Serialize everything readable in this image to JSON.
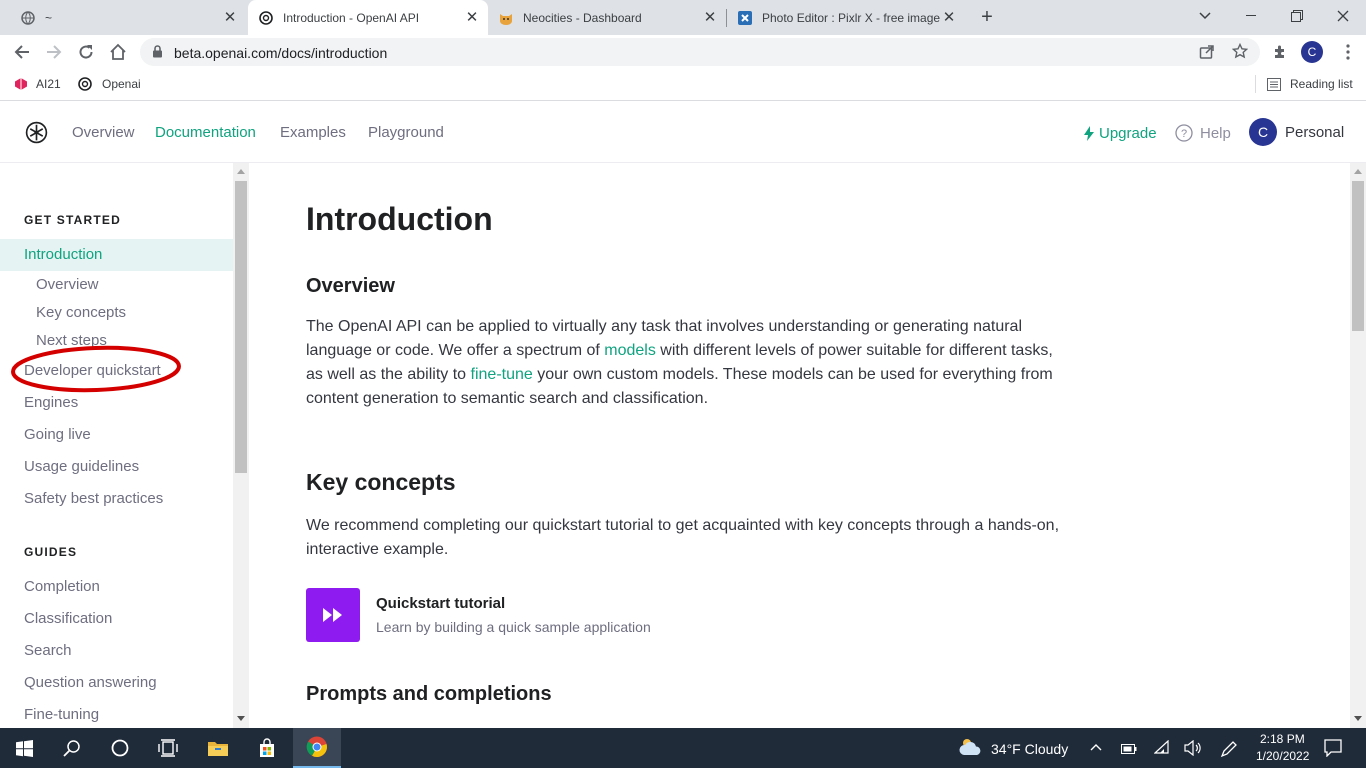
{
  "browser": {
    "tabs": [
      {
        "title": "~",
        "favicon": "globe-icon"
      },
      {
        "title": "Introduction - OpenAI API",
        "favicon": "openai-icon"
      },
      {
        "title": "Neocities - Dashboard",
        "favicon": "neocities-cat-icon"
      },
      {
        "title": "Photo Editor : Pixlr X - free image",
        "favicon": "pixlr-icon"
      }
    ],
    "url": "beta.openai.com/docs/introduction",
    "profile_initial": "C",
    "bookmarks": [
      {
        "label": "AI21",
        "icon": "ai21-icon"
      },
      {
        "label": "Openai",
        "icon": "openai-icon"
      }
    ],
    "reading_list": "Reading list"
  },
  "site": {
    "nav": [
      "Overview",
      "Documentation",
      "Examples",
      "Playground"
    ],
    "active_nav": "Documentation",
    "upgrade": "Upgrade",
    "help": "Help",
    "account_initial": "C",
    "account_name": "Personal"
  },
  "sidebar": {
    "get_started_heading": "GET STARTED",
    "get_started": {
      "introduction": "Introduction",
      "sub": [
        "Overview",
        "Key concepts",
        "Next steps"
      ],
      "items": [
        "Developer quickstart",
        "Engines",
        "Going live",
        "Usage guidelines",
        "Safety best practices"
      ]
    },
    "guides_heading": "GUIDES",
    "guides": [
      "Completion",
      "Classification",
      "Search",
      "Question answering",
      "Fine-tuning"
    ]
  },
  "content": {
    "title": "Introduction",
    "overview_heading": "Overview",
    "overview": {
      "p1": "The OpenAI API can be applied to virtually any task that involves understanding or generating natural language or code. We offer a spectrum of ",
      "link1": "models",
      "p2": " with different levels of power suitable for different tasks, as well as the ability to ",
      "link2": "fine-tune",
      "p3": " your own custom models. These models can be used for everything from content generation to semantic search and classification."
    },
    "key_concepts_heading": "Key concepts",
    "key_concepts_text": "We recommend completing our quickstart tutorial to get acquainted with key concepts through a hands-on, interactive example.",
    "quickstart": {
      "title": "Quickstart tutorial",
      "subtitle": "Learn by building a quick sample application"
    },
    "prompts_heading": "Prompts and completions"
  },
  "taskbar": {
    "weather": "34°F  Cloudy",
    "time": "2:18 PM",
    "date": "1/20/2022"
  },
  "colors": {
    "accent": "#10a37f",
    "highlight": "#e6f3f3",
    "quickstart_tile": "#8e1cf0",
    "annotation": "#d40000",
    "taskbar": "#202b3a"
  }
}
